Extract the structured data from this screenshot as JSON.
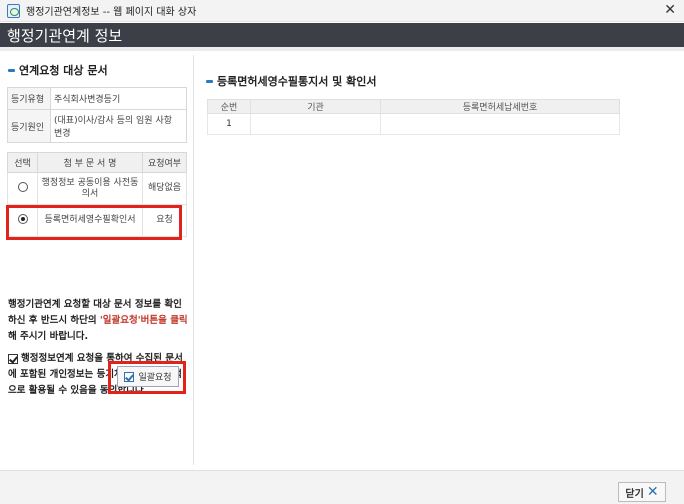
{
  "window": {
    "title": "행정기관연계정보 -- 웹 페이지 대화 상자",
    "close_glyph": "✕"
  },
  "header": {
    "title": "행정기관연계 정보"
  },
  "left": {
    "section_title": "연계요청 대상 문서",
    "info": [
      {
        "label": "등기유형",
        "value": "주식회사변경등기"
      },
      {
        "label": "등기원인",
        "value": "(대표)이사/감사 등의 임원 사항 변경"
      }
    ],
    "docs_header": {
      "select": "선택",
      "doc_name": "첨 부 문 서 명",
      "request": "요청여부"
    },
    "docs": [
      {
        "name": "행정정보 공동이용 사전동의서",
        "status": "해당없음",
        "selected": false
      },
      {
        "name": "등록면허세영수필확인서",
        "status": "요청",
        "selected": true
      }
    ],
    "notice": {
      "part1": "행정기관연계 요청할 대상 문서 정보를 확인하신 후 반드시 하단의 ",
      "highlight": "'일괄요청'버튼을 클릭",
      "part2": "해 주시기 바랍니다."
    },
    "agree_text": "행정정보연계 요청을 통하여 수집된 문서에 포함된 개인정보는 등기처리 업무의 목적으로 활용될 수 있음을 동의합니다.",
    "agree_checked": true,
    "bulk_button": "일괄요청"
  },
  "right": {
    "title": "등록면허세영수필통지서 및 확인서",
    "columns": [
      "순번",
      "기관",
      "등록면허세납세번호"
    ],
    "rows": [
      {
        "no": "1",
        "agency": "",
        "tax_no": ""
      }
    ]
  },
  "footer": {
    "close_label": "닫기",
    "close_icon": "✕"
  },
  "colors": {
    "header_bg": "#3c3f47",
    "accent": "#2b7bc0",
    "highlight": "#e2231a"
  }
}
